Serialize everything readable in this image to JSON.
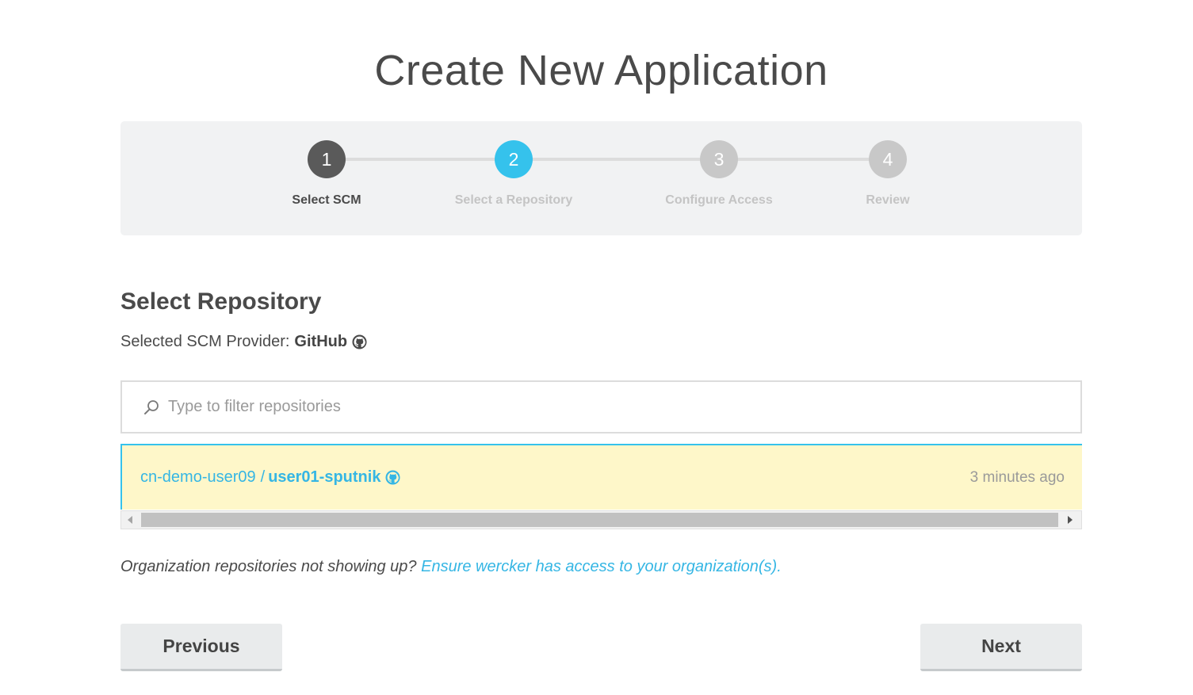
{
  "page": {
    "title": "Create New Application"
  },
  "stepper": {
    "steps": [
      {
        "number": "1",
        "label": "Select SCM",
        "state": "done"
      },
      {
        "number": "2",
        "label": "Select a Repository",
        "state": "active"
      },
      {
        "number": "3",
        "label": "Configure Access",
        "state": "todo"
      },
      {
        "number": "4",
        "label": "Review",
        "state": "todo"
      }
    ]
  },
  "section": {
    "title": "Select Repository",
    "provider_prefix": "Selected SCM Provider:",
    "provider_name": "GitHub",
    "provider_icon": "github-icon"
  },
  "filter": {
    "placeholder": "Type to filter repositories",
    "value": "",
    "icon": "search-icon"
  },
  "repositories": [
    {
      "owner": "cn-demo-user09",
      "separator": "/",
      "name": "user01-sputnik",
      "icon": "github-icon",
      "updated": "3 minutes ago",
      "selected": true
    }
  ],
  "org_note": {
    "text": "Organization repositories not showing up?",
    "link": "Ensure wercker has access to your organization(s)."
  },
  "buttons": {
    "previous": "Previous",
    "next": "Next"
  },
  "colors": {
    "accent": "#35c2ec",
    "selected_row": "#fef7c9",
    "step_done": "#5a5a5a",
    "step_todo": "#c8c8c8"
  }
}
